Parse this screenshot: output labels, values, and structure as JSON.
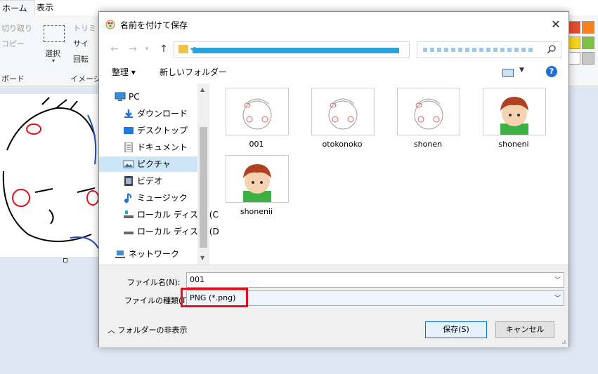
{
  "paint": {
    "tabs": [
      "ホーム",
      "表示"
    ],
    "ribbon": {
      "cut": "切り取り",
      "copy": "コピー",
      "clipboard_group": "ボード",
      "select": "選択",
      "trim": "トリミ",
      "resize": "サイ",
      "rotate": "回転",
      "image_group": "イメージ"
    },
    "palette": [
      "#e54b2a",
      "#f7821b",
      "#f7d51b",
      "#ffffff",
      "#7fc241",
      "#c8c8c8",
      "#f0c24b",
      "#ffffff"
    ]
  },
  "dialog": {
    "title": "名前を付けて保存",
    "close": "✕",
    "address_prefix": "<",
    "toolbar": {
      "organize": "整理 ▾",
      "new_folder": "新しいフォルダー",
      "help": "?"
    },
    "nav_items": [
      {
        "label": "PC",
        "icon": "pc-icon"
      },
      {
        "label": "ダウンロード",
        "icon": "download-icon"
      },
      {
        "label": "デスクトップ",
        "icon": "desktop-icon"
      },
      {
        "label": "ドキュメント",
        "icon": "document-icon"
      },
      {
        "label": "ピクチャ",
        "icon": "pictures-icon",
        "selected": true
      },
      {
        "label": "ビデオ",
        "icon": "video-icon"
      },
      {
        "label": "ミュージック",
        "icon": "music-icon"
      },
      {
        "label": "ローカル ディスク (C",
        "icon": "drive-icon"
      },
      {
        "label": "ローカル ディスク (D",
        "icon": "drive-icon"
      },
      {
        "label": "ネットワーク",
        "icon": "network-icon"
      }
    ],
    "files": [
      {
        "name": "001",
        "style": "sketch"
      },
      {
        "name": "otokonoko",
        "style": "sketch"
      },
      {
        "name": "shonen",
        "style": "sketch"
      },
      {
        "name": "shoneni",
        "style": "color"
      },
      {
        "name": "shonenii",
        "style": "color"
      }
    ],
    "filename_label": "ファイル名(N):",
    "filename_value": "001",
    "filetype_label": "ファイルの種類(T):",
    "filetype_value": "PNG (*.png)",
    "hide_folders": "フォルダーの非表示",
    "save_button": "保存(S)",
    "cancel_button": "キャンセル"
  },
  "colors": {
    "highlight": "#e0111b",
    "accent": "#0078d7",
    "selected": "#cde6f7"
  }
}
